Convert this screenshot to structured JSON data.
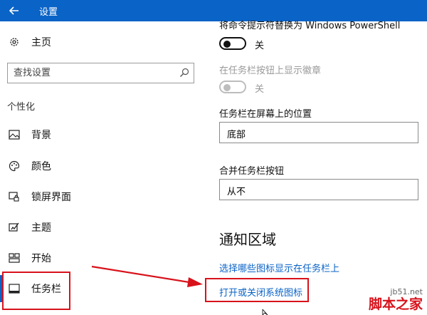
{
  "window": {
    "title": "设置",
    "accent": "#0a63c7"
  },
  "sidebar": {
    "home_label": "主页",
    "search_placeholder": "查找设置",
    "section_header": "个性化",
    "items": [
      {
        "label": "背景",
        "icon": "image-icon"
      },
      {
        "label": "颜色",
        "icon": "palette-icon"
      },
      {
        "label": "锁屏界面",
        "icon": "lock-screen-icon"
      },
      {
        "label": "主题",
        "icon": "theme-icon"
      },
      {
        "label": "开始",
        "icon": "start-grid-icon"
      },
      {
        "label": "任务栏",
        "icon": "taskbar-icon",
        "selected": true
      }
    ]
  },
  "content": {
    "powershell_setting": {
      "label": "将命令提示符替换为 Windows PowerShell",
      "state": "关"
    },
    "badge_setting": {
      "label": "在任务栏按钮上显示徽章",
      "state": "关",
      "disabled": true
    },
    "location_setting": {
      "label": "任务栏在屏幕上的位置",
      "value": "底部"
    },
    "combine_setting": {
      "label": "合并任务栏按钮",
      "value": "从不"
    },
    "notification_header": "通知区域",
    "links": [
      "选择哪些图标显示在任务栏上",
      "打开或关闭系统图标"
    ]
  },
  "annotation": {
    "color": "#d8121b"
  },
  "watermark": {
    "site": "jb51.net",
    "brand": "脚本之家"
  }
}
